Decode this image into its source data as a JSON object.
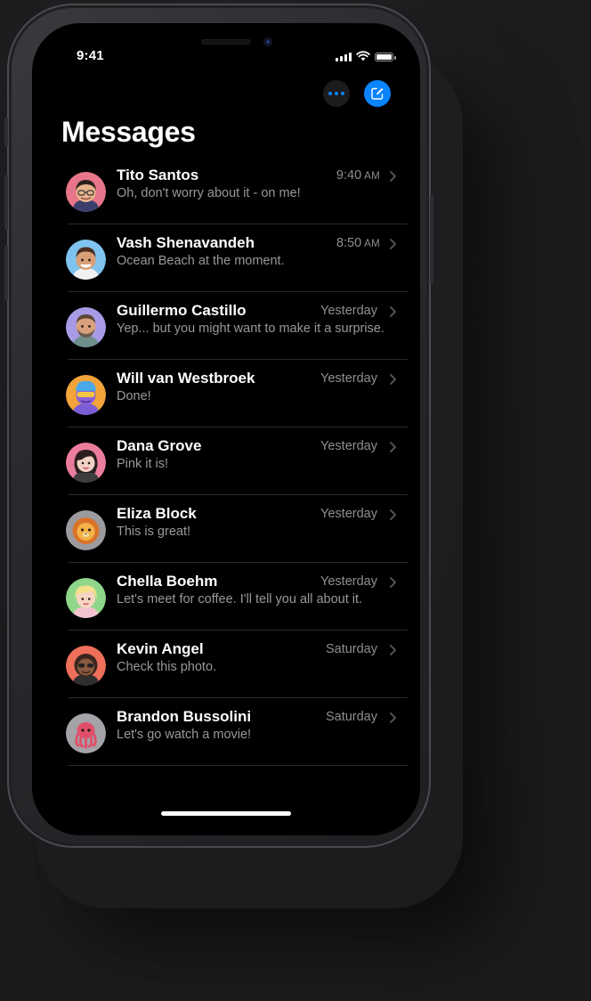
{
  "status_bar": {
    "time": "9:41",
    "icons": [
      "cellular-signal-icon",
      "wifi-icon",
      "battery-icon"
    ]
  },
  "toolbar": {
    "more_icon": "ellipsis-icon",
    "compose_icon": "compose-icon"
  },
  "header": {
    "title": "Messages"
  },
  "accent_color": "#0a84ff",
  "conversations": [
    {
      "name": "Tito Santos",
      "preview": "Oh, don't worry about it - on me!",
      "time": "9:40",
      "meridiem": "AM",
      "avatar_color": "#e8768a"
    },
    {
      "name": "Vash Shenavandeh",
      "preview": "Ocean Beach at the moment.",
      "time": "8:50",
      "meridiem": "AM",
      "avatar_color": "#7fc3ee"
    },
    {
      "name": "Guillermo Castillo",
      "preview": "Yep... but you might want to make it a surprise.",
      "time": "Yesterday",
      "meridiem": "",
      "avatar_color": "#a99ae6"
    },
    {
      "name": "Will van Westbroek",
      "preview": "Done!",
      "time": "Yesterday",
      "meridiem": "",
      "avatar_color": "#f2a33a"
    },
    {
      "name": "Dana Grove",
      "preview": "Pink it is!",
      "time": "Yesterday",
      "meridiem": "",
      "avatar_color": "#ec7d9c"
    },
    {
      "name": "Eliza Block",
      "preview": "This is great!",
      "time": "Yesterday",
      "meridiem": "",
      "avatar_color": "#9a9a9f"
    },
    {
      "name": "Chella Boehm",
      "preview": "Let's meet for coffee. I'll tell you all about it.",
      "time": "Yesterday",
      "meridiem": "",
      "avatar_color": "#8fd68a"
    },
    {
      "name": "Kevin Angel",
      "preview": "Check this photo.",
      "time": "Saturday",
      "meridiem": "",
      "avatar_color": "#ee6f5a"
    },
    {
      "name": "Brandon Bussolini",
      "preview": "Let's go watch a movie!",
      "time": "Saturday",
      "meridiem": "",
      "avatar_color": "#a3a3a8"
    }
  ]
}
